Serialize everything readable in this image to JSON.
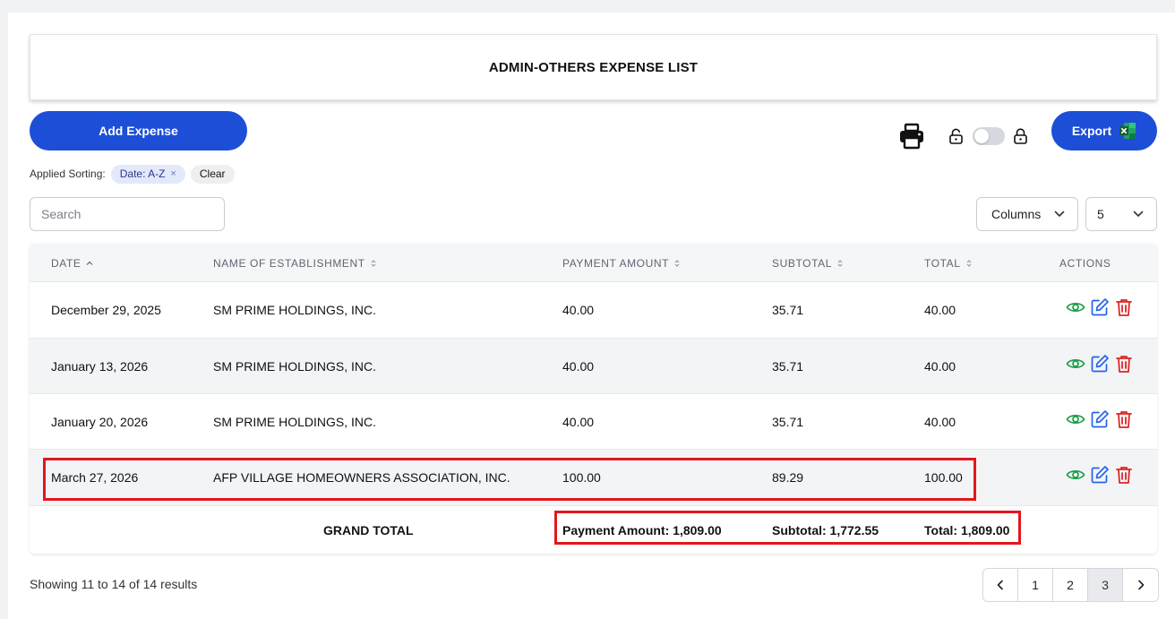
{
  "page": {
    "title": "ADMIN-OTHERS EXPENSE LIST"
  },
  "toolbar": {
    "add_label": "Add Expense",
    "export_label": "Export",
    "print_icon": "printer-icon",
    "unlock_icon": "unlock-icon",
    "lock_icon": "lock-icon",
    "toggle_state": "off",
    "accent_color": "#1d4ed8"
  },
  "sorting": {
    "label": "Applied Sorting:",
    "chip": "Date: A-Z",
    "chip_remove": "×",
    "clear": "Clear"
  },
  "search": {
    "placeholder": "Search",
    "value": ""
  },
  "controls": {
    "columns_label": "Columns",
    "page_size": "5"
  },
  "table": {
    "headers": {
      "date": "DATE",
      "establishment": "NAME OF ESTABLISHMENT",
      "payment": "PAYMENT AMOUNT",
      "subtotal": "SUBTOTAL",
      "total": "TOTAL",
      "actions": "ACTIONS"
    },
    "rows": [
      {
        "date": "December 29, 2025",
        "establishment": "SM PRIME HOLDINGS, INC.",
        "payment": "40.00",
        "subtotal": "35.71",
        "total": "40.00"
      },
      {
        "date": "January 13, 2026",
        "establishment": "SM PRIME HOLDINGS, INC.",
        "payment": "40.00",
        "subtotal": "35.71",
        "total": "40.00"
      },
      {
        "date": "January 20, 2026",
        "establishment": "SM PRIME HOLDINGS, INC.",
        "payment": "40.00",
        "subtotal": "35.71",
        "total": "40.00"
      },
      {
        "date": "March 27, 2026",
        "establishment": "AFP VILLAGE HOMEOWNERS ASSOCIATION, INC.",
        "payment": "100.00",
        "subtotal": "89.29",
        "total": "100.00"
      }
    ],
    "grand_total": {
      "label": "GRAND TOTAL",
      "payment": "Payment Amount: 1,809.00",
      "subtotal": "Subtotal: 1,772.55",
      "total": "Total: 1,809.00"
    },
    "action_icons": [
      "eye-icon",
      "edit-icon",
      "trash-icon"
    ],
    "action_colors": {
      "view": "#1e9e4a",
      "edit": "#2563eb",
      "delete": "#dc2626"
    }
  },
  "footer": {
    "showing": "Showing 11 to 14 of 14 results",
    "pages": [
      "1",
      "2",
      "3"
    ],
    "current_page": "3"
  }
}
